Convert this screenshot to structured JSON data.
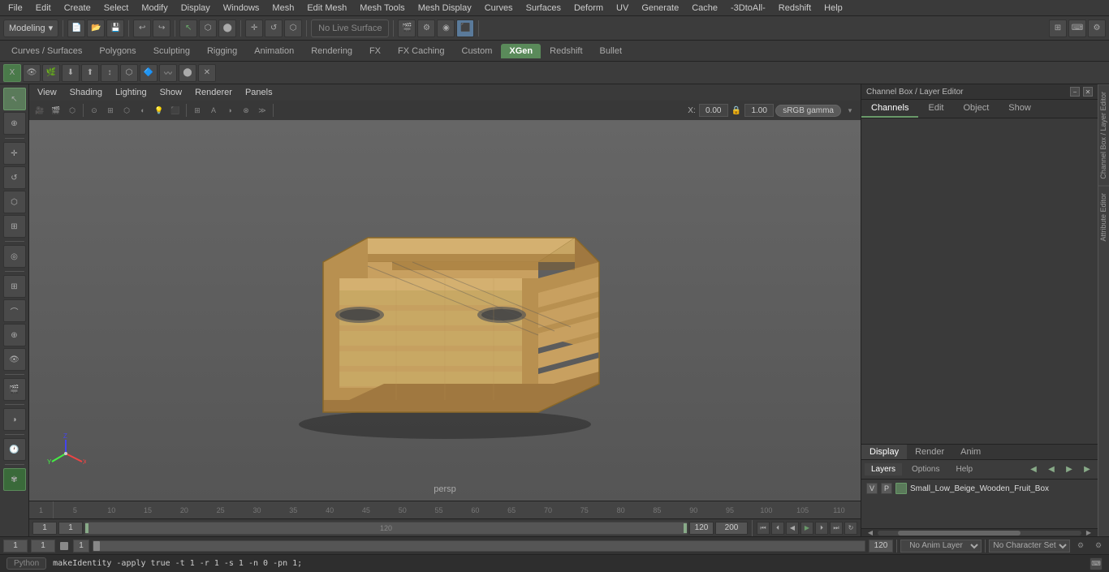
{
  "menubar": {
    "items": [
      "File",
      "Edit",
      "Create",
      "Select",
      "Modify",
      "Display",
      "Windows",
      "Mesh",
      "Edit Mesh",
      "Mesh Tools",
      "Mesh Display",
      "Curves",
      "Surfaces",
      "Deform",
      "UV",
      "Generate",
      "Cache",
      "-3DtoAll-",
      "Redshift",
      "Help"
    ]
  },
  "toolbar1": {
    "mode_label": "Modeling",
    "no_live_surface": "No Live Surface"
  },
  "mode_tabs": {
    "items": [
      "Curves / Surfaces",
      "Polygons",
      "Sculpting",
      "Rigging",
      "Animation",
      "Rendering",
      "FX",
      "FX Caching",
      "Custom",
      "XGen",
      "Redshift",
      "Bullet"
    ],
    "active": "XGen"
  },
  "viewport": {
    "menu": [
      "View",
      "Shading",
      "Lighting",
      "Show",
      "Renderer",
      "Panels"
    ],
    "persp": "persp",
    "coord_x": "0.00",
    "coord_y": "1.00",
    "color_space": "sRGB gamma"
  },
  "channel_box": {
    "title": "Channel Box / Layer Editor",
    "tabs": [
      "Channels",
      "Edit",
      "Object",
      "Show"
    ],
    "active_tab": "Channels"
  },
  "layer_editor": {
    "tabs": [
      "Display",
      "Render",
      "Anim"
    ],
    "active_tab": "Display",
    "sub_tabs": [
      "Layers",
      "Options",
      "Help"
    ],
    "active_sub_tab": "Layers",
    "layers": [
      {
        "vis": "V",
        "ref": "P",
        "name": "Small_Low_Beige_Wooden_Fruit_Box"
      }
    ]
  },
  "timeline": {
    "ticks": [
      "5",
      "10",
      "15",
      "20",
      "25",
      "30",
      "35",
      "40",
      "45",
      "50",
      "55",
      "60",
      "65",
      "70",
      "75",
      "80",
      "85",
      "90",
      "95",
      "100",
      "105",
      "110"
    ],
    "current_frame": "1",
    "start_frame": "1",
    "end_frame": "120",
    "playback_end": "120",
    "total_frames": "200"
  },
  "bottom_bar": {
    "frame_fields": [
      "1",
      "1"
    ],
    "anim_layer": "No Anim Layer",
    "char_set": "No Character Set"
  },
  "status_bar": {
    "python_label": "Python",
    "command": "makeIdentity -apply true -t 1 -r 1 -s 1 -n 0 -pn 1;"
  },
  "icons": {
    "arrow": "▶",
    "move": "✛",
    "rotate": "↺",
    "scale": "⬡",
    "select": "↖",
    "camera": "📷",
    "rewind": "⏮",
    "step_back": "⏪",
    "back": "◀",
    "play": "▶",
    "step_fwd": "⏩",
    "fwd_end": "⏭",
    "loop": "🔁"
  }
}
